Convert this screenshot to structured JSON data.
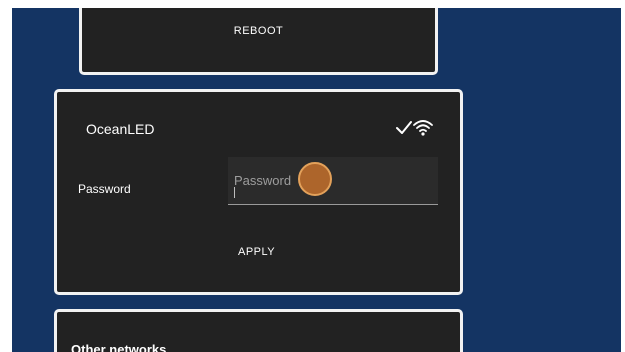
{
  "reboot": {
    "button_label": "REBOOT"
  },
  "network": {
    "ssid": "OceanLED",
    "password_label": "Password",
    "password_placeholder": "Password",
    "password_value": "",
    "apply_label": "APPLY",
    "status_icons": [
      "checkmark-icon",
      "wifi-icon"
    ]
  },
  "other_networks": {
    "title": "Other networks"
  },
  "colors": {
    "background": "#143463",
    "card": "#222222",
    "card_border": "#f2f2f2",
    "touch_indicator": "#c4702c"
  }
}
